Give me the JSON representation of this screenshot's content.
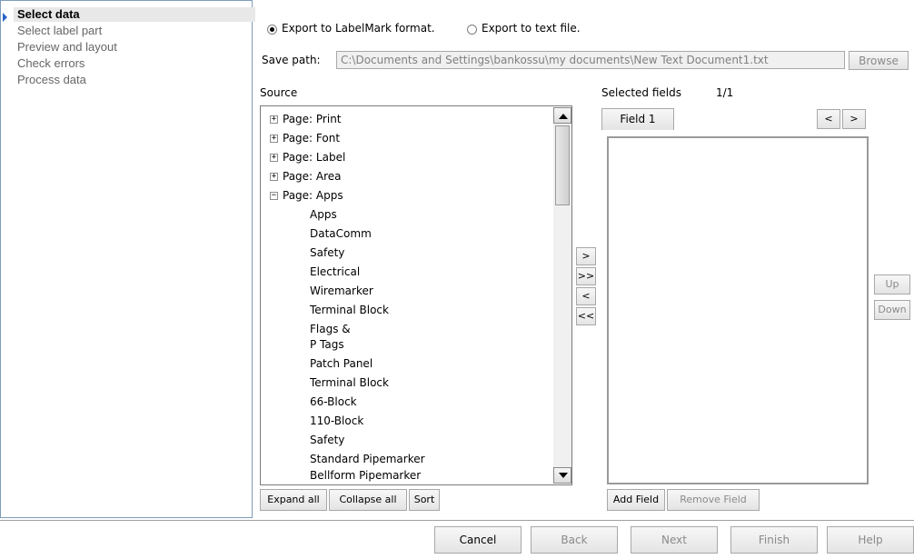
{
  "steps": [
    {
      "label": "Select data",
      "active": true
    },
    {
      "label": "Select label part",
      "active": false
    },
    {
      "label": "Preview and layout",
      "active": false
    },
    {
      "label": "Check errors",
      "active": false
    },
    {
      "label": "Process data",
      "active": false
    }
  ],
  "export": {
    "option_labelmark": "Export to LabelMark format.",
    "option_text": "Export to text file.",
    "selected": "labelmark"
  },
  "save_path": {
    "label": "Save path:",
    "value": "C:\\Documents and Settings\\bankossu\\my documents\\New Text Document1.txt",
    "browse": "Browse"
  },
  "source": {
    "title": "Source",
    "items": [
      {
        "label": "Page: Print",
        "toggle": "+"
      },
      {
        "label": "Page: Font",
        "toggle": "+"
      },
      {
        "label": "Page: Label",
        "toggle": "+"
      },
      {
        "label": "Page: Area",
        "toggle": "+"
      },
      {
        "label": "Page: Apps",
        "toggle": "−"
      },
      {
        "label": "Apps",
        "toggle": ""
      },
      {
        "label": "DataComm",
        "toggle": ""
      },
      {
        "label": "Safety",
        "toggle": ""
      },
      {
        "label": "Electrical",
        "toggle": ""
      },
      {
        "label": "Wiremarker",
        "toggle": ""
      },
      {
        "label": "Terminal Block",
        "toggle": ""
      },
      {
        "label": "Flags &",
        "toggle": ""
      },
      {
        "label": "P Tags",
        "toggle": ""
      },
      {
        "label": "Patch Panel",
        "toggle": ""
      },
      {
        "label": "Terminal Block",
        "toggle": ""
      },
      {
        "label": "66-Block",
        "toggle": ""
      },
      {
        "label": "110-Block",
        "toggle": ""
      },
      {
        "label": "Safety",
        "toggle": ""
      },
      {
        "label": "Standard Pipemarker",
        "toggle": ""
      },
      {
        "label": "Bellform Pipemarker",
        "toggle": ""
      }
    ],
    "expand_all": "Expand all",
    "collapse_all": "Collapse all",
    "sort": "Sort"
  },
  "transfer": {
    "add": ">",
    "add_all": ">>",
    "remove": "<",
    "remove_all": "<<"
  },
  "selected_fields": {
    "title": "Selected fields",
    "counter": "1/1",
    "tab": "Field 1",
    "prev": "<",
    "next": ">",
    "add_field": "Add Field",
    "remove_field": "Remove Field",
    "up": "Up",
    "down": "Down"
  },
  "footer": {
    "cancel": "Cancel",
    "back": "Back",
    "next": "Next",
    "finish": "Finish",
    "help": "Help"
  }
}
